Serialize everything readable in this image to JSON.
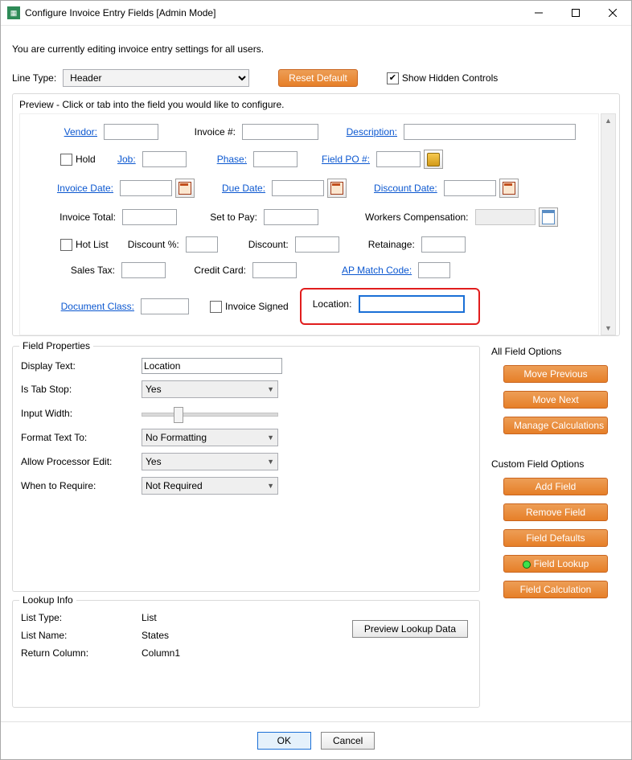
{
  "window_title": "Configure Invoice Entry Fields [Admin Mode]",
  "intro_text": "You are currently editing invoice entry settings for all users.",
  "linetype_label": "Line Type:",
  "linetype_value": "Header",
  "reset_default_label": "Reset Default",
  "show_hidden_label": "Show Hidden Controls",
  "show_hidden_checked": true,
  "preview_section_label": "Preview - Click or tab into the field you would like to configure.",
  "preview": {
    "vendor_label": "Vendor:",
    "invoice_num_label": "Invoice #:",
    "description_label": "Description:",
    "hold_label": "Hold",
    "job_label": "Job:",
    "phase_label": "Phase:",
    "field_po_label": "Field PO #:",
    "invoice_date_label": "Invoice Date:",
    "due_date_label": "Due Date:",
    "discount_date_label": "Discount Date:",
    "invoice_total_label": "Invoice Total:",
    "set_to_pay_label": "Set to Pay:",
    "workers_comp_label": "Workers Compensation:",
    "hot_list_label": "Hot List",
    "discount_pct_label": "Discount %:",
    "discount_label": "Discount:",
    "retainage_label": "Retainage:",
    "sales_tax_label": "Sales Tax:",
    "credit_card_label": "Credit Card:",
    "ap_match_code_label": "AP Match Code:",
    "document_class_label": "Document Class:",
    "invoice_signed_label": "Invoice Signed",
    "location_label": "Location:"
  },
  "field_properties": {
    "section_title": "Field Properties",
    "display_text_label": "Display Text:",
    "display_text_value": "Location",
    "is_tab_stop_label": "Is Tab Stop:",
    "is_tab_stop_value": "Yes",
    "input_width_label": "Input Width:",
    "format_text_label": "Format Text To:",
    "format_text_value": "No Formatting",
    "allow_processor_edit_label": "Allow Processor Edit:",
    "allow_processor_edit_value": "Yes",
    "when_to_require_label": "When to Require:",
    "when_to_require_value": "Not Required"
  },
  "all_field_options": {
    "section_title": "All Field Options",
    "move_previous": "Move Previous",
    "move_next": "Move Next",
    "manage_calculations": "Manage Calculations"
  },
  "custom_field_options": {
    "section_title": "Custom Field Options",
    "add_field": "Add Field",
    "remove_field": "Remove Field",
    "field_defaults": "Field Defaults",
    "field_lookup": "Field Lookup",
    "field_calculation": "Field Calculation"
  },
  "lookup_info": {
    "section_title": "Lookup Info",
    "list_type_label": "List Type:",
    "list_type_value": "List",
    "list_name_label": "List Name:",
    "list_name_value": "States",
    "return_column_label": "Return Column:",
    "return_column_value": "Column1",
    "preview_lookup_label": "Preview Lookup Data"
  },
  "footer": {
    "ok_label": "OK",
    "cancel_label": "Cancel"
  }
}
